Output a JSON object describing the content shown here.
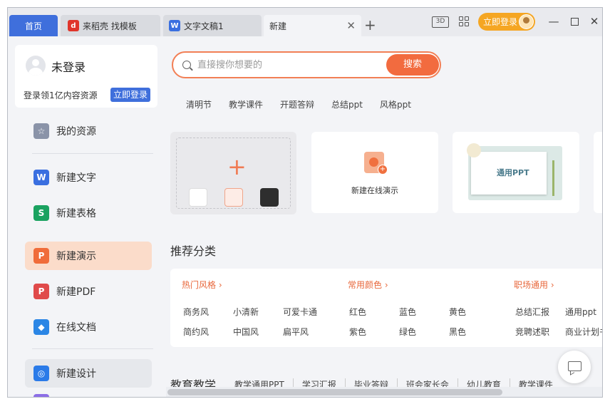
{
  "tabs": [
    {
      "label": "首页"
    },
    {
      "label": "来稻壳 找模板"
    },
    {
      "label": "文字文稿1"
    },
    {
      "label": "新建"
    }
  ],
  "titlebar": {
    "login_label": "立即登录",
    "view_icon_label": "3D"
  },
  "sidebar": {
    "user": {
      "name": "未登录",
      "promo": "登录领1亿内容资源",
      "login_label": "立即登录"
    },
    "items": [
      {
        "label": "我的资源",
        "icon": "star-icon"
      },
      {
        "label": "新建文字",
        "icon": "writer-icon",
        "color": "#3a6fe0"
      },
      {
        "label": "新建表格",
        "icon": "spreadsheet-icon",
        "color": "#1aa260"
      },
      {
        "label": "新建演示",
        "icon": "presentation-icon",
        "color": "#f06c3a"
      },
      {
        "label": "新建PDF",
        "icon": "pdf-icon",
        "color": "#e04a4a"
      },
      {
        "label": "在线文档",
        "icon": "cloud-doc-icon",
        "color": "#2b86e5"
      },
      {
        "label": "新建设计",
        "icon": "design-icon",
        "color": "#2b7be8"
      }
    ]
  },
  "search": {
    "placeholder": "直接搜你想要的",
    "button_label": "搜索"
  },
  "hot_tags": [
    "清明节",
    "教学课件",
    "开题答辩",
    "总结ppt",
    "风格ppt"
  ],
  "cards": {
    "online_label": "新建在线演示",
    "ppt_template_label": "通用PPT"
  },
  "recommend": {
    "title": "推荐分类",
    "groups": [
      {
        "title": "热门风格",
        "items": [
          "商务风",
          "小清新",
          "可爱卡通",
          "简约风",
          "中国风",
          "扁平风"
        ]
      },
      {
        "title": "常用颜色",
        "items": [
          "红色",
          "蓝色",
          "黄色",
          "紫色",
          "绿色",
          "黑色"
        ]
      },
      {
        "title": "职场通用",
        "items": [
          "总结汇报",
          "通用ppt",
          "竞聘述职",
          "商业计划书"
        ]
      }
    ]
  },
  "education": {
    "title": "教育教学",
    "items": [
      "教学通用PPT",
      "学习汇报",
      "毕业答辩",
      "班会家长会",
      "幼儿教育",
      "教学课件"
    ]
  }
}
